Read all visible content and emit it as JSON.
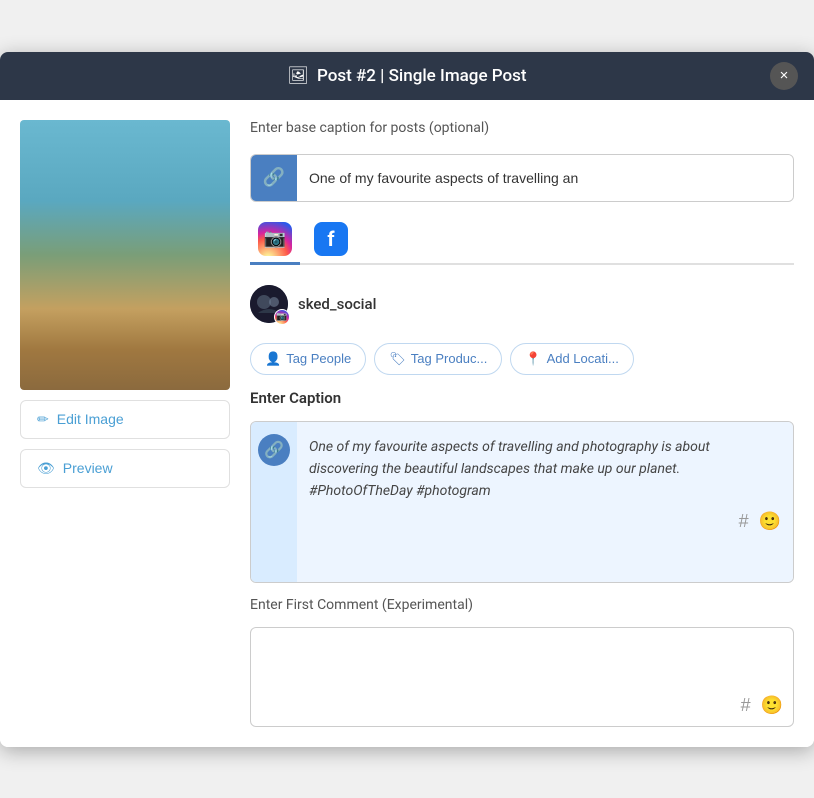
{
  "modal": {
    "title": "Post #2 | Single Image Post",
    "close_label": "×"
  },
  "header": {
    "image_icon": "🖼"
  },
  "left_panel": {
    "edit_image_label": "Edit Image",
    "preview_label": "Preview",
    "edit_icon": "✏",
    "preview_icon": "👁"
  },
  "right_panel": {
    "base_caption_label": "Enter base caption for posts (optional)",
    "base_caption_value": "One of my favourite aspects of travelling an",
    "base_caption_placeholder": "One of my favourite aspects of travelling an",
    "platform_tabs": [
      {
        "id": "instagram",
        "label": "Instagram",
        "active": true
      },
      {
        "id": "facebook",
        "label": "Facebook",
        "active": false
      }
    ],
    "account_name": "sked_social",
    "tag_buttons": [
      {
        "id": "tag-people",
        "label": "Tag People",
        "icon": "👤"
      },
      {
        "id": "tag-products",
        "label": "Tag Produc...",
        "icon": "🏷"
      },
      {
        "id": "add-location",
        "label": "Add Locati...",
        "icon": "📍"
      }
    ],
    "caption_label": "Enter Caption",
    "caption_text": "One of my favourite aspects of travelling and photography is about discovering the beautiful landscapes that make up our planet. #PhotoOfTheDay #photogram",
    "first_comment_label": "Enter First Comment (Experimental)",
    "first_comment_placeholder": ""
  }
}
